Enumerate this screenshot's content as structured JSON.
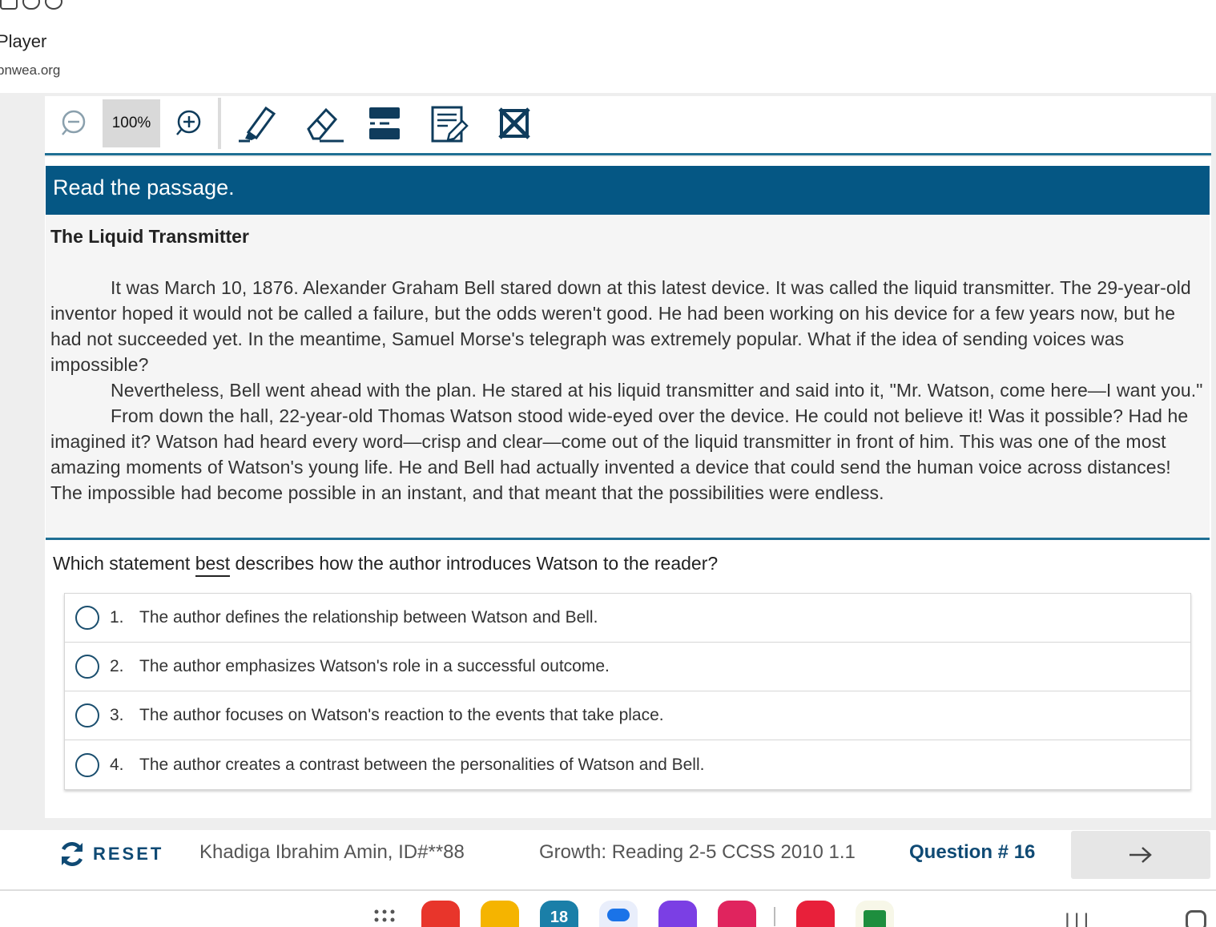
{
  "browser": {
    "title": "Player",
    "url": "pnwea.org"
  },
  "toolbar": {
    "zoom_level": "100%",
    "tools": [
      "zoom-out-icon",
      "zoom-in-icon",
      "highlighter-icon",
      "eraser-icon",
      "line-reader-icon",
      "notepad-icon",
      "answer-eliminator-icon"
    ]
  },
  "passage": {
    "header": "Read the passage.",
    "title": "The Liquid Transmitter",
    "paragraphs": [
      "It was March 10, 1876. Alexander Graham Bell stared down at this latest device. It was called the liquid transmitter. The 29-year-old inventor hoped it would not be called a failure, but the odds weren't good. He had been working on his device for a few years now, but he had not succeeded yet. In the meantime, Samuel Morse's telegraph was extremely popular. What if the idea of sending voices was impossible?",
      "Nevertheless, Bell went ahead with the plan. He stared at his liquid transmitter and said into it, \"Mr. Watson, come here—I want you.\"",
      "From down the hall, 22-year-old Thomas Watson stood wide-eyed over the device. He could not believe it! Was it possible? Had he imagined it? Watson had heard every word—crisp and clear—come out of the liquid transmitter in front of him. This was one of the most amazing moments of Watson's young life. He and Bell had actually invented a device that could send the human voice across distances! The impossible had become possible in an instant, and that meant that the possibilities were endless."
    ]
  },
  "question": {
    "prefix": "Which statement ",
    "emphasis": "best",
    "suffix": " describes how the author introduces Watson to the reader?"
  },
  "answers": [
    {
      "num": "1.",
      "text": "The author defines the relationship between Watson and Bell."
    },
    {
      "num": "2.",
      "text": "The author emphasizes Watson's role in a successful outcome."
    },
    {
      "num": "3.",
      "text": "The author focuses on Watson's reaction to the events that take place."
    },
    {
      "num": "4.",
      "text": "The author creates a contrast between the personalities of Watson and Bell."
    }
  ],
  "footer": {
    "reset_label": "RESET",
    "student": "Khadiga Ibrahim Amin, ID#**88",
    "test_name": "Growth: Reading 2-5 CCSS 2010 1.1",
    "question_number": "Question # 16"
  },
  "dock": {
    "calendar_day": "18",
    "app_colors": [
      "#e8352b",
      "#f5b400",
      "#1a7fa8",
      "#1a73e8",
      "#7b3fe4",
      "#e0245e",
      "#e8203a",
      "#1e8e3e"
    ]
  },
  "colors": {
    "header_bg": "#055784",
    "accent": "#0f4a74",
    "rule": "#1f6f94"
  }
}
